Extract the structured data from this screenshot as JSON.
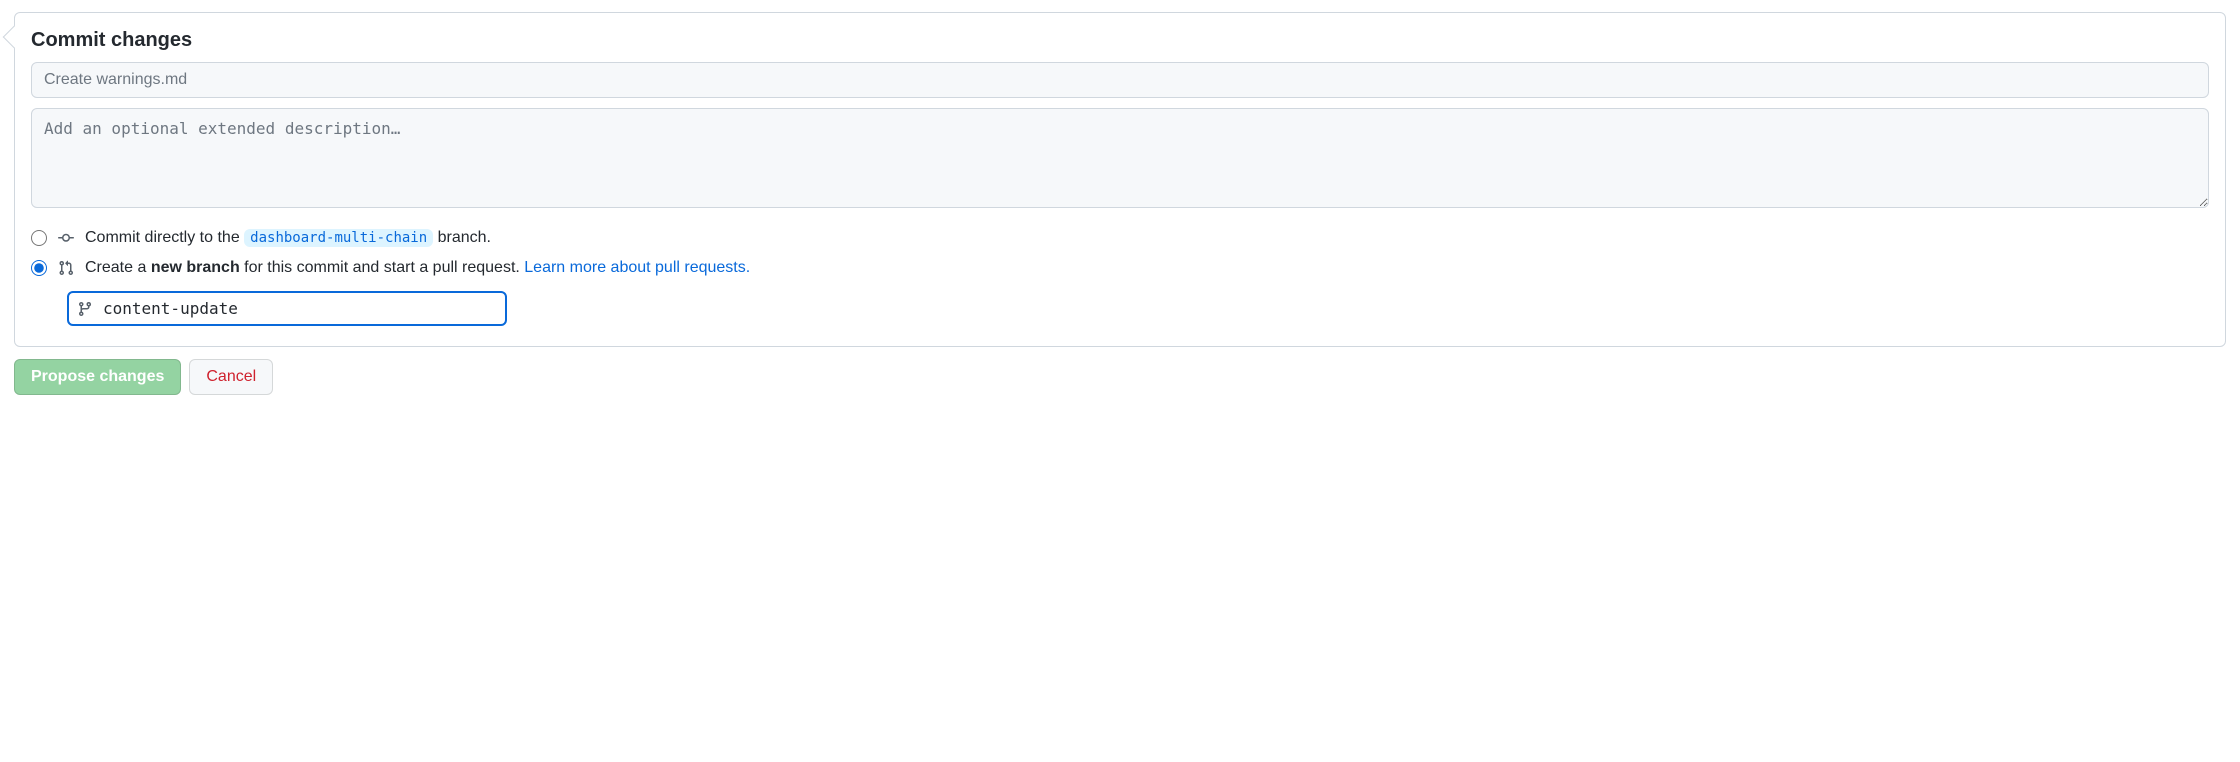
{
  "form": {
    "heading": "Commit changes",
    "summary_placeholder": "Create warnings.md",
    "summary_value": "",
    "description_placeholder": "Add an optional extended description…",
    "description_value": "",
    "branch_name_value": "content-update"
  },
  "options": {
    "direct": {
      "prefix": "Commit directly to the ",
      "branch": "dashboard-multi-chain",
      "suffix": " branch."
    },
    "new_branch": {
      "prefix": "Create a ",
      "bold": "new branch",
      "mid": " for this commit and start a pull request. ",
      "link": "Learn more about pull requests."
    }
  },
  "actions": {
    "propose": "Propose changes",
    "cancel": "Cancel"
  }
}
